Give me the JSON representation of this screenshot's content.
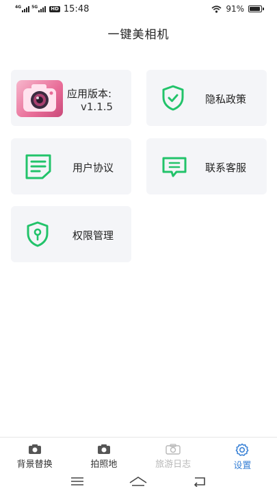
{
  "status_bar": {
    "net1": "4G",
    "net2": "5G",
    "hd": "HD",
    "time": "15:48",
    "battery_percent": "91%",
    "battery_level": 0.91
  },
  "page": {
    "title": "一键美相机"
  },
  "cards": {
    "version": {
      "label": "应用版本:",
      "value": "v1.1.5"
    },
    "privacy": {
      "label": "隐私政策"
    },
    "agreement": {
      "label": "用户协议"
    },
    "contact": {
      "label": "联系客服"
    },
    "permissions": {
      "label": "权限管理"
    }
  },
  "tabs": [
    {
      "label": "背景替换",
      "icon": "camera-icon",
      "state": "normal"
    },
    {
      "label": "拍照地",
      "icon": "camera-icon",
      "state": "normal"
    },
    {
      "label": "旅游日志",
      "icon": "camera-outline-icon",
      "state": "disabled"
    },
    {
      "label": "设置",
      "icon": "gear-icon",
      "state": "active"
    }
  ],
  "colors": {
    "accent_green": "#22c36a",
    "tab_active": "#3a82d6",
    "card_bg": "#f4f5f8"
  }
}
